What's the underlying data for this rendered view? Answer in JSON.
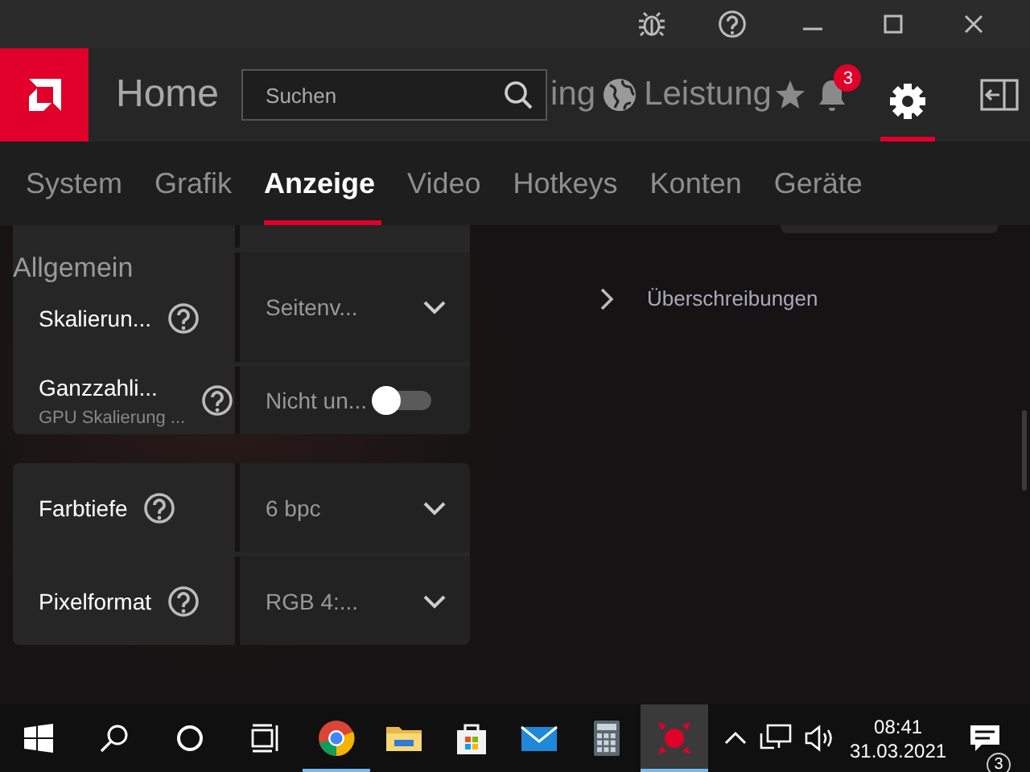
{
  "nav": {
    "home": "Home",
    "search": {
      "placeholder": "Suchen"
    },
    "partial_labels": [
      "ing",
      "Leistung"
    ],
    "notification_count": "3",
    "settings_selected": true
  },
  "tabs": [
    {
      "label": "System",
      "selected": false
    },
    {
      "label": "Grafik",
      "selected": false
    },
    {
      "label": "Anzeige",
      "selected": true
    },
    {
      "label": "Video",
      "selected": false
    },
    {
      "label": "Hotkeys",
      "selected": false
    },
    {
      "label": "Konten",
      "selected": false
    },
    {
      "label": "Geräte",
      "selected": false
    }
  ],
  "settings": {
    "heading": "Allgemein",
    "groups": [
      {
        "partial_top": true,
        "rows": [
          {
            "kind": "dropdown",
            "label": "Skalierun...",
            "value": "Seitenv..."
          },
          {
            "kind": "toggle",
            "label": "Ganzzahli...",
            "sublabel": "GPU Skalierung ...",
            "value": "Nicht un...",
            "on": false
          }
        ]
      },
      {
        "partial_top": false,
        "rows": [
          {
            "kind": "dropdown",
            "label": "Farbtiefe",
            "value": "6 bpc"
          },
          {
            "kind": "dropdown",
            "label": "Pixelformat",
            "value": "RGB 4:..."
          }
        ]
      }
    ]
  },
  "overrides": {
    "label": "Überschreibungen",
    "expanded": false
  },
  "taskbar": {
    "apps": [
      {
        "kind": "browser",
        "running": true,
        "selected": false
      },
      {
        "kind": "folder",
        "running": false,
        "selected": false
      },
      {
        "kind": "store",
        "running": false,
        "selected": false
      },
      {
        "kind": "mail",
        "running": false,
        "selected": false
      },
      {
        "kind": "calculator",
        "running": false,
        "selected": false
      },
      {
        "kind": "amd",
        "running": true,
        "selected": true
      }
    ],
    "time": "08:41",
    "date": "31.03.2021",
    "notifications": "3"
  }
}
